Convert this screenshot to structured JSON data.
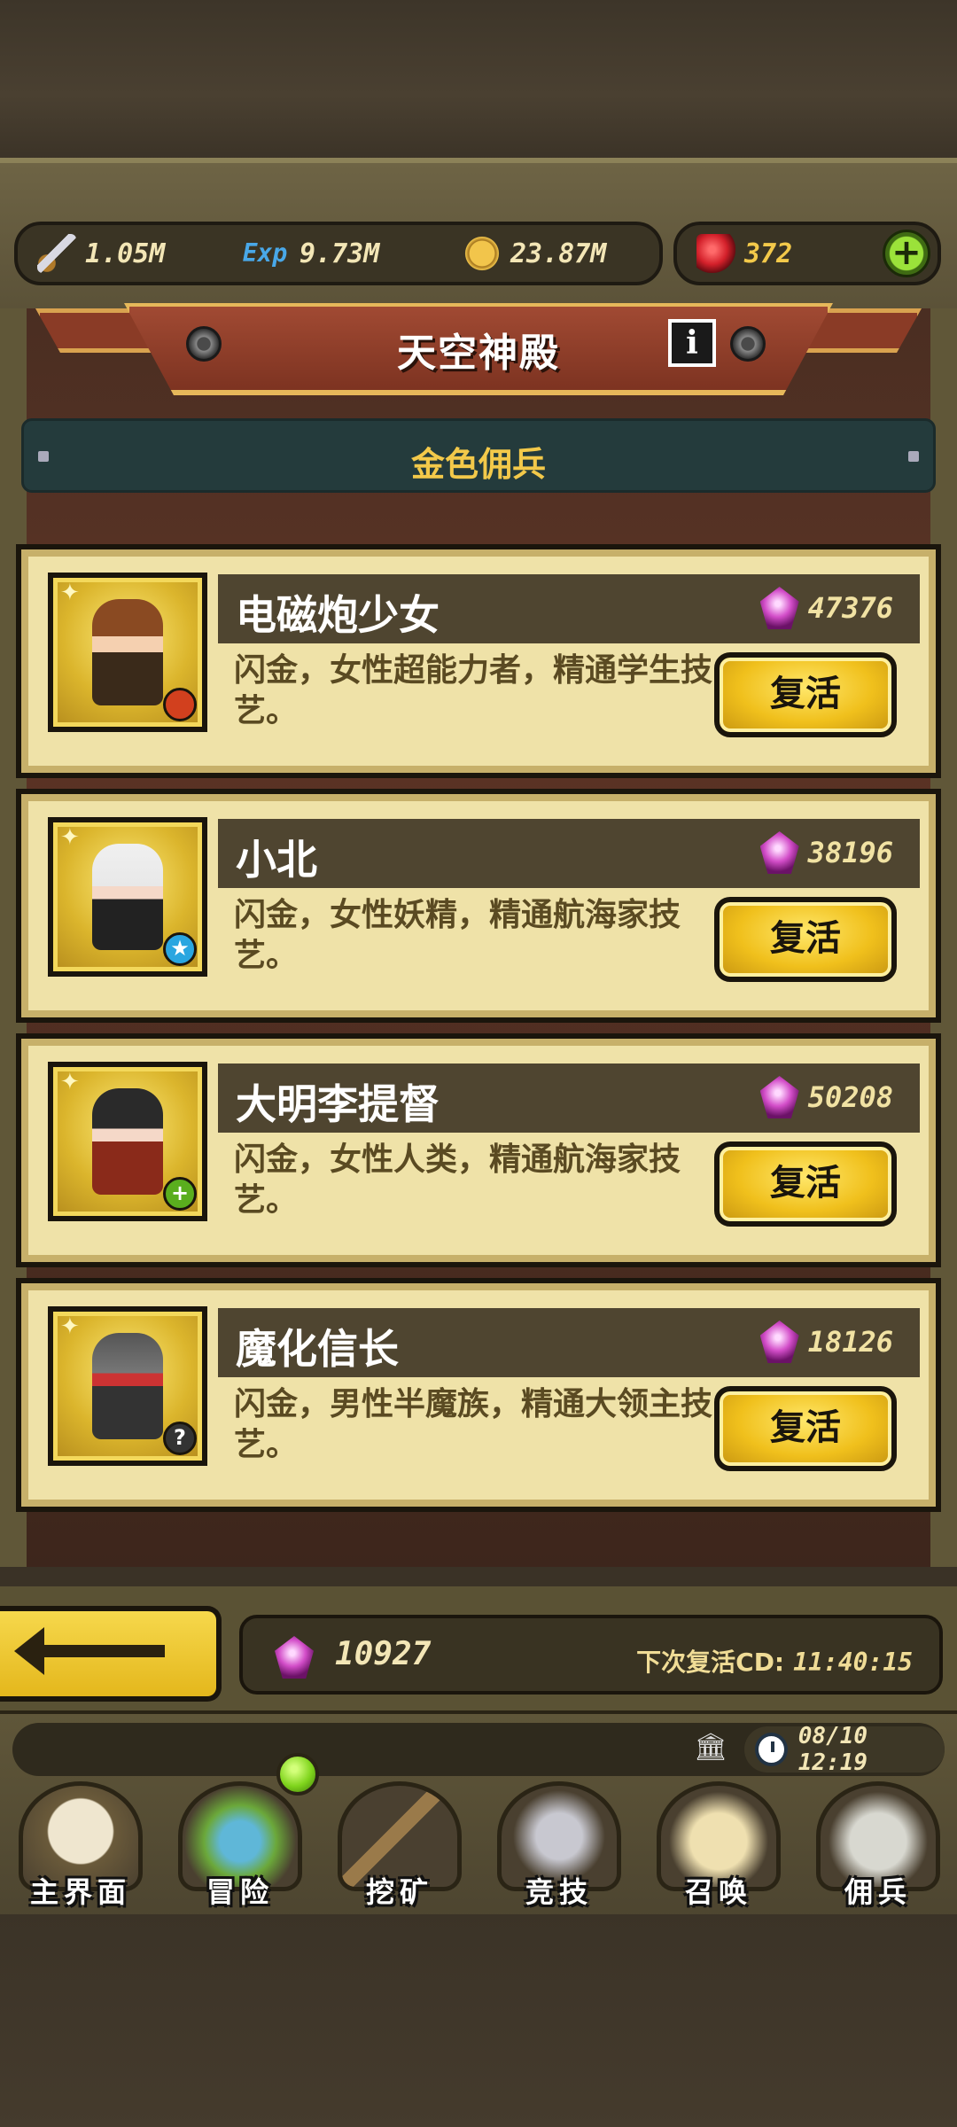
{
  "resources": {
    "attack": "1.05M",
    "exp_label": "Exp",
    "exp": "9.73M",
    "gold": "23.87M",
    "ruby": "372",
    "add_label": "+"
  },
  "header": {
    "title": "天空神殿",
    "info_label": "i"
  },
  "section": {
    "title": "金色佣兵"
  },
  "mercenaries": [
    {
      "name": "电磁炮少女",
      "price": "47376",
      "description": "闪金，女性超能力者，精通学生技艺。",
      "action": "复活",
      "badge": "",
      "badge_color": "#d2401e"
    },
    {
      "name": "小北",
      "price": "38196",
      "description": "闪金，女性妖精，精通航海家技艺。",
      "action": "复活",
      "badge": "★",
      "badge_color": "#2aa6e0"
    },
    {
      "name": "大明李提督",
      "price": "50208",
      "description": "闪金，女性人类，精通航海家技艺。",
      "action": "复活",
      "badge": "+",
      "badge_color": "#5aae1e"
    },
    {
      "name": "魔化信长",
      "price": "18126",
      "description": "闪金，男性半魔族，精通大领主技艺。",
      "action": "复活",
      "badge": "?",
      "badge_color": "#333333"
    }
  ],
  "footer": {
    "gem_total": "10927",
    "cooldown_label": "下次复活CD:",
    "cooldown_value": "11:40:15"
  },
  "status": {
    "datetime": "08/10 12:19"
  },
  "nav": [
    {
      "label": "主界面",
      "icon": "scroll-map-icon"
    },
    {
      "label": "冒险",
      "icon": "island-icon"
    },
    {
      "label": "挖矿",
      "icon": "pickaxe-icon"
    },
    {
      "label": "竞技",
      "icon": "crossed-swords-icon"
    },
    {
      "label": "召唤",
      "icon": "summon-scroll-icon"
    },
    {
      "label": "佣兵",
      "icon": "tent-icon"
    }
  ],
  "colors": {
    "accent_gold": "#f3c94a",
    "card_bg": "#efe2a8",
    "gem_purple": "#d24dc8"
  }
}
